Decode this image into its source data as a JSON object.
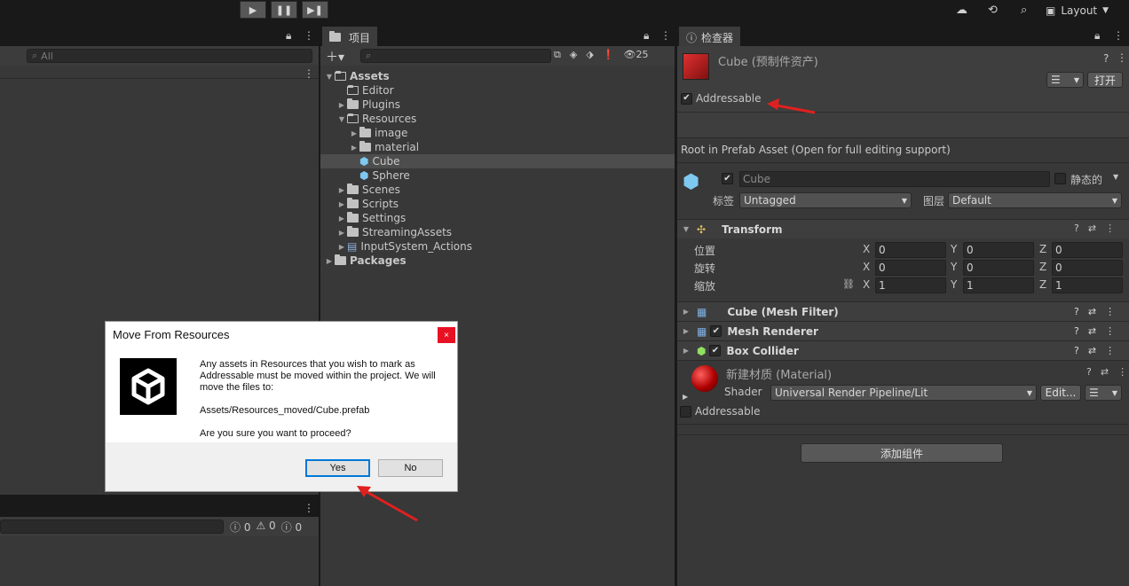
{
  "toolbar": {
    "layout_label": "Layout"
  },
  "left_panel": {
    "search_placeholder": "All",
    "console_counts": [
      "0",
      "0",
      "0"
    ]
  },
  "project": {
    "tab_label": "项目",
    "hidden_count": "25",
    "tree": [
      {
        "label": "Assets",
        "depth": 0,
        "arrow": "▼",
        "bold": true,
        "icon": "folder-open"
      },
      {
        "label": "Editor",
        "depth": 1,
        "arrow": "",
        "icon": "folder-open"
      },
      {
        "label": "Plugins",
        "depth": 1,
        "arrow": "▶",
        "icon": "folder"
      },
      {
        "label": "Resources",
        "depth": 1,
        "arrow": "▼",
        "icon": "folder-open"
      },
      {
        "label": "image",
        "depth": 2,
        "arrow": "▶",
        "icon": "folder"
      },
      {
        "label": "material",
        "depth": 2,
        "arrow": "▶",
        "icon": "folder"
      },
      {
        "label": "Cube",
        "depth": 2,
        "arrow": "",
        "icon": "prefab",
        "selected": true
      },
      {
        "label": "Sphere",
        "depth": 2,
        "arrow": "",
        "icon": "prefab"
      },
      {
        "label": "Scenes",
        "depth": 1,
        "arrow": "▶",
        "icon": "folder"
      },
      {
        "label": "Scripts",
        "depth": 1,
        "arrow": "▶",
        "icon": "folder"
      },
      {
        "label": "Settings",
        "depth": 1,
        "arrow": "▶",
        "icon": "folder"
      },
      {
        "label": "StreamingAssets",
        "depth": 1,
        "arrow": "▶",
        "icon": "folder"
      },
      {
        "label": "InputSystem_Actions",
        "depth": 1,
        "arrow": "▶",
        "icon": "input-actions"
      },
      {
        "label": "Packages",
        "depth": 0,
        "arrow": "▶",
        "bold": true,
        "icon": "folder"
      }
    ]
  },
  "inspector": {
    "tab_label": "检查器",
    "asset_title": "Cube (预制件资产)",
    "open_button": "打开",
    "addressable_label": "Addressable",
    "root_info": "Root in Prefab Asset (Open for full editing support)",
    "object_name": "Cube",
    "static_label": "静态的",
    "tag_label": "标签",
    "tag_value": "Untagged",
    "layer_label": "图层",
    "layer_value": "Default",
    "transform": {
      "title": "Transform",
      "rows": [
        {
          "label": "位置",
          "x": "0",
          "y": "0",
          "z": "0"
        },
        {
          "label": "旋转",
          "x": "0",
          "y": "0",
          "z": "0"
        },
        {
          "label": "缩放",
          "x": "1",
          "y": "1",
          "z": "1"
        }
      ],
      "axis_x": "X",
      "axis_y": "Y",
      "axis_z": "Z"
    },
    "components": [
      "Cube (Mesh Filter)",
      "Mesh Renderer",
      "Box Collider"
    ],
    "material": {
      "title": "新建材质 (Material)",
      "shader_label": "Shader",
      "shader_value": "Universal Render Pipeline/Lit",
      "edit_button": "Edit...",
      "addressable_label": "Addressable"
    },
    "add_component": "添加组件"
  },
  "dialog": {
    "title": "Move From Resources",
    "message_1": "Any assets in Resources that you wish to mark as Addressable must be moved within the project. We will move the files to:",
    "message_2": "Assets/Resources_moved/Cube.prefab",
    "message_3": "Are you sure you want to proceed?",
    "yes": "Yes",
    "no": "No",
    "close": "×"
  },
  "colors": {
    "accent_arrow": "#e02020",
    "prefab_blue": "#7fc8f0",
    "selection": "#4d4d4d"
  }
}
